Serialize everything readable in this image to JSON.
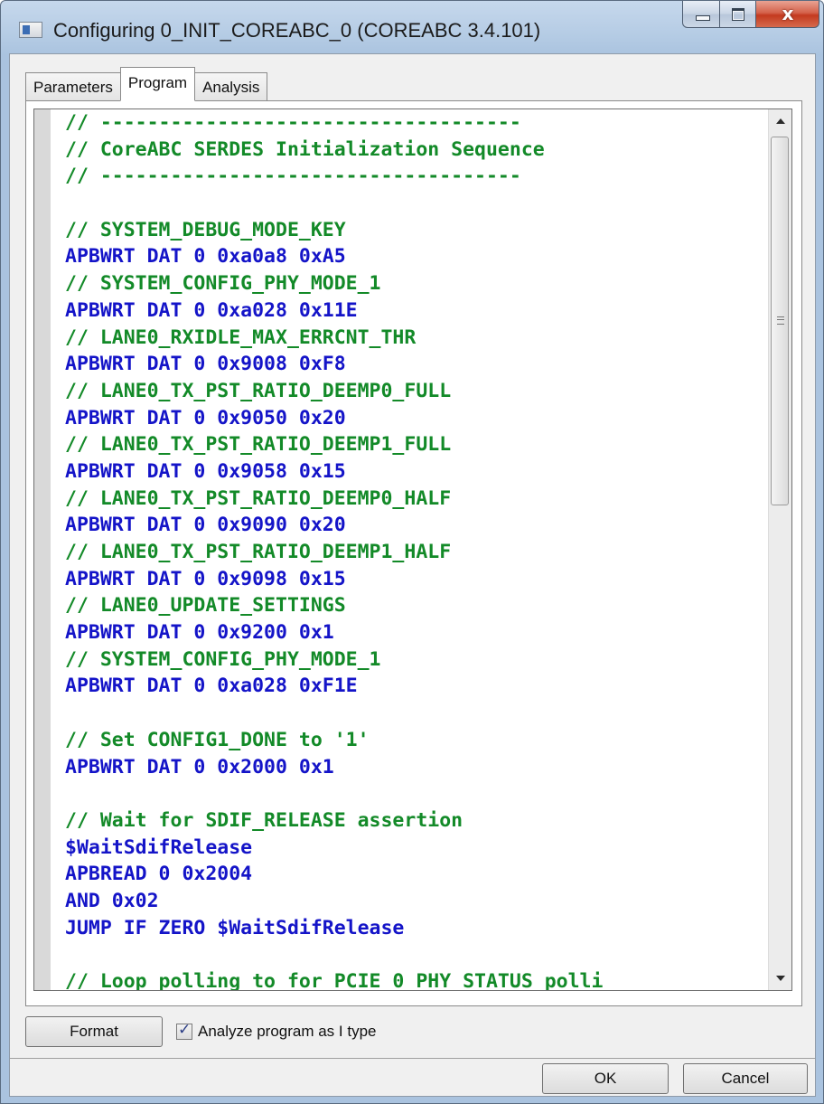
{
  "window": {
    "title": "Configuring 0_INIT_COREABC_0 (COREABC 3.4.101)",
    "close_glyph": "x"
  },
  "tabs": [
    {
      "label": "Parameters",
      "active": false
    },
    {
      "label": "Program",
      "active": true
    },
    {
      "label": "Analysis",
      "active": false
    }
  ],
  "editor": {
    "lines": [
      {
        "text": "// ------------------------------------",
        "kind": "comment"
      },
      {
        "text": "// CoreABC SERDES Initialization Sequence",
        "kind": "comment"
      },
      {
        "text": "// ------------------------------------",
        "kind": "comment"
      },
      {
        "text": "",
        "kind": "blank"
      },
      {
        "text": "// SYSTEM_DEBUG_MODE_KEY",
        "kind": "comment"
      },
      {
        "text": "APBWRT DAT 0 0xa0a8 0xA5",
        "kind": "code"
      },
      {
        "text": "// SYSTEM_CONFIG_PHY_MODE_1",
        "kind": "comment"
      },
      {
        "text": "APBWRT DAT 0 0xa028 0x11E",
        "kind": "code"
      },
      {
        "text": "// LANE0_RXIDLE_MAX_ERRCNT_THR",
        "kind": "comment"
      },
      {
        "text": "APBWRT DAT 0 0x9008 0xF8",
        "kind": "code"
      },
      {
        "text": "// LANE0_TX_PST_RATIO_DEEMP0_FULL",
        "kind": "comment"
      },
      {
        "text": "APBWRT DAT 0 0x9050 0x20",
        "kind": "code"
      },
      {
        "text": "// LANE0_TX_PST_RATIO_DEEMP1_FULL",
        "kind": "comment"
      },
      {
        "text": "APBWRT DAT 0 0x9058 0x15",
        "kind": "code"
      },
      {
        "text": "// LANE0_TX_PST_RATIO_DEEMP0_HALF",
        "kind": "comment"
      },
      {
        "text": "APBWRT DAT 0 0x9090 0x20",
        "kind": "code"
      },
      {
        "text": "// LANE0_TX_PST_RATIO_DEEMP1_HALF",
        "kind": "comment"
      },
      {
        "text": "APBWRT DAT 0 0x9098 0x15",
        "kind": "code"
      },
      {
        "text": "// LANE0_UPDATE_SETTINGS",
        "kind": "comment"
      },
      {
        "text": "APBWRT DAT 0 0x9200 0x1",
        "kind": "code"
      },
      {
        "text": "// SYSTEM_CONFIG_PHY_MODE_1",
        "kind": "comment"
      },
      {
        "text": "APBWRT DAT 0 0xa028 0xF1E",
        "kind": "code"
      },
      {
        "text": "",
        "kind": "blank"
      },
      {
        "text": "// Set CONFIG1_DONE to '1'",
        "kind": "comment"
      },
      {
        "text": "APBWRT DAT 0 0x2000 0x1",
        "kind": "code"
      },
      {
        "text": "",
        "kind": "blank"
      },
      {
        "text": "// Wait for SDIF_RELEASE assertion",
        "kind": "comment"
      },
      {
        "text": "$WaitSdifRelease",
        "kind": "code"
      },
      {
        "text": "APBREAD 0 0x2004",
        "kind": "code"
      },
      {
        "text": "AND 0x02",
        "kind": "code"
      },
      {
        "text": "JUMP IF ZERO $WaitSdifRelease",
        "kind": "code"
      },
      {
        "text": "",
        "kind": "blank"
      },
      {
        "text": "// Loop polling to for PCIE_0_PHY_STATUS polli",
        "kind": "comment"
      }
    ],
    "scroll_fraction": 0.0
  },
  "controls": {
    "format_label": "Format",
    "analyze_label": "Analyze program as I type",
    "analyze_checked": true,
    "check_glyph": "✓"
  },
  "footer": {
    "ok_label": "OK",
    "cancel_label": "Cancel"
  }
}
